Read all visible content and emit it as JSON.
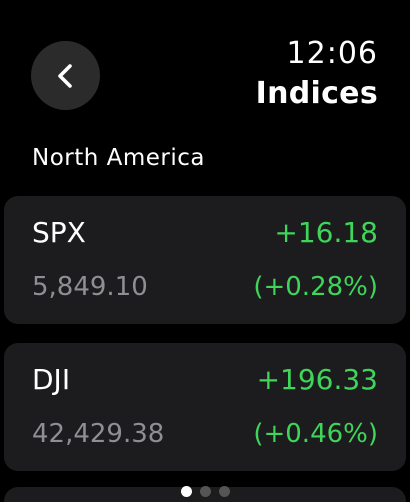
{
  "header": {
    "time": "12:06",
    "title": "Indices",
    "back_icon": "chevron-left-icon"
  },
  "section": {
    "heading": "North America"
  },
  "indices": [
    {
      "symbol": "SPX",
      "change": "+16.18",
      "price": "5,849.10",
      "percent": "(+0.28%)"
    },
    {
      "symbol": "DJI",
      "change": "+196.33",
      "price": "42,429.38",
      "percent": "(+0.46%)"
    }
  ],
  "pagination": {
    "total": 3,
    "active": 1
  },
  "colors": {
    "background": "#000000",
    "card": "#1c1c1e",
    "positive": "#3fd45a",
    "secondary_text": "#8e8e93",
    "back_button": "#2b2b2b"
  }
}
